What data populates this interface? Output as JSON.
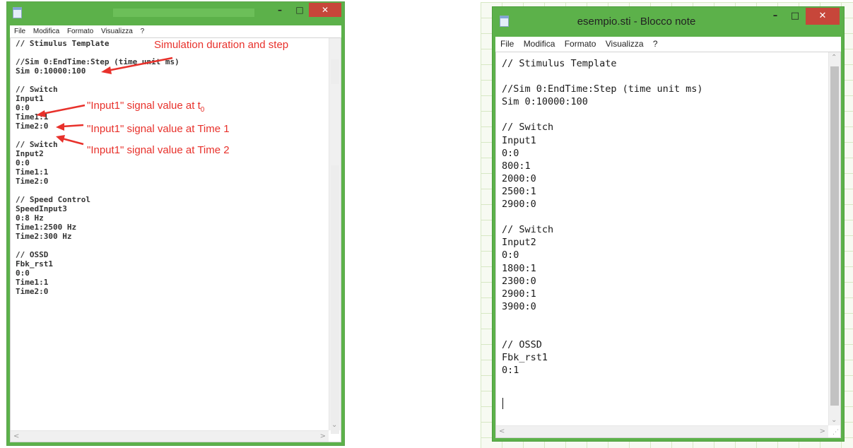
{
  "left_window": {
    "title": "",
    "menu": [
      "File",
      "Modifica",
      "Formato",
      "Visualizza",
      "?"
    ],
    "content": "// Stimulus Template\n\n//Sim 0:EndTime:Step (time unit ms)\nSim 0:10000:100\n\n// Switch\nInput1\n0:0\nTime1:1\nTime2:0\n\n// Switch\nInput2\n0:0\nTime1:1\nTime2:0\n\n// Speed Control\nSpeedInput3\n0:8 Hz\nTime1:2500 Hz\nTime2:300 Hz\n\n// OSSD\nFbk_rst1\n0:0\nTime1:1\nTime2:0"
  },
  "annotations": {
    "sim": "Simulation duration and step",
    "t0_prefix": "\"Input1\" signal value at t",
    "t0_sub": "0",
    "time1": "\"Input1\" signal value at Time 1",
    "time2": "\"Input1\" signal value at Time 2",
    "color": "#e8312b"
  },
  "right_window": {
    "title": "esempio.sti - Blocco note",
    "menu": [
      "File",
      "Modifica",
      "Formato",
      "Visualizza",
      "?"
    ],
    "content": "// Stimulus Template\n\n//Sim 0:EndTime:Step (time unit ms)\nSim 0:10000:100\n\n// Switch\nInput1\n0:0\n800:1\n2000:0\n2500:1\n2900:0\n\n// Switch\nInput2\n0:0\n1800:1\n2300:0\n2900:1\n3900:0\n\n\n// OSSD\nFbk_rst1\n0:1"
  },
  "window_controls": {
    "minimize": "–",
    "maximize": "□",
    "close": "✕"
  },
  "colors": {
    "title_bar": "#5cb14a",
    "close_button": "#c7463a"
  }
}
